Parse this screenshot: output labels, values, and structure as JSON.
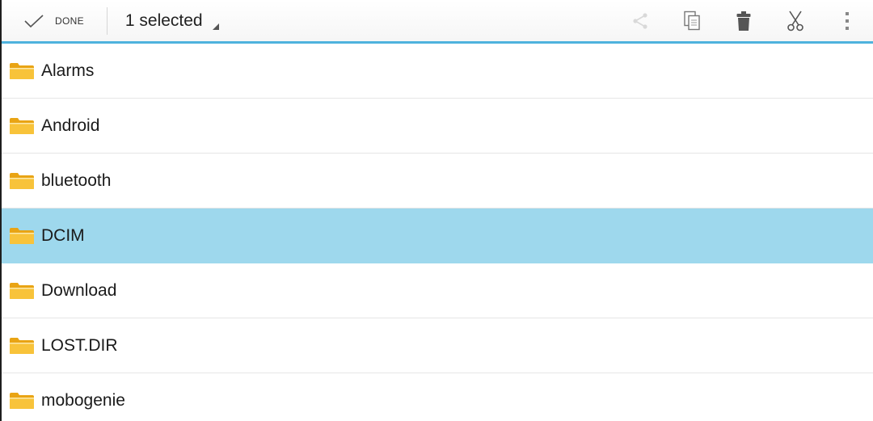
{
  "action_bar": {
    "done_label": "DONE",
    "selection_label": "1 selected",
    "actions": [
      {
        "name": "share-icon",
        "icon": "share",
        "enabled": false
      },
      {
        "name": "copy-icon",
        "icon": "copy",
        "enabled": true
      },
      {
        "name": "delete-icon",
        "icon": "trash",
        "enabled": true
      },
      {
        "name": "cut-icon",
        "icon": "scissors",
        "enabled": true
      },
      {
        "name": "overflow-menu-icon",
        "icon": "more-vertical",
        "enabled": true
      }
    ],
    "accent_color": "#4fb2dd"
  },
  "files": [
    {
      "name": "Alarms",
      "selected": false
    },
    {
      "name": "Android",
      "selected": false
    },
    {
      "name": "bluetooth",
      "selected": false
    },
    {
      "name": "DCIM",
      "selected": true
    },
    {
      "name": "Download",
      "selected": false
    },
    {
      "name": "LOST.DIR",
      "selected": false
    },
    {
      "name": "mobogenie",
      "selected": false
    }
  ],
  "colors": {
    "selected_row": "#9ed8ed",
    "folder": "#f5b81c"
  }
}
